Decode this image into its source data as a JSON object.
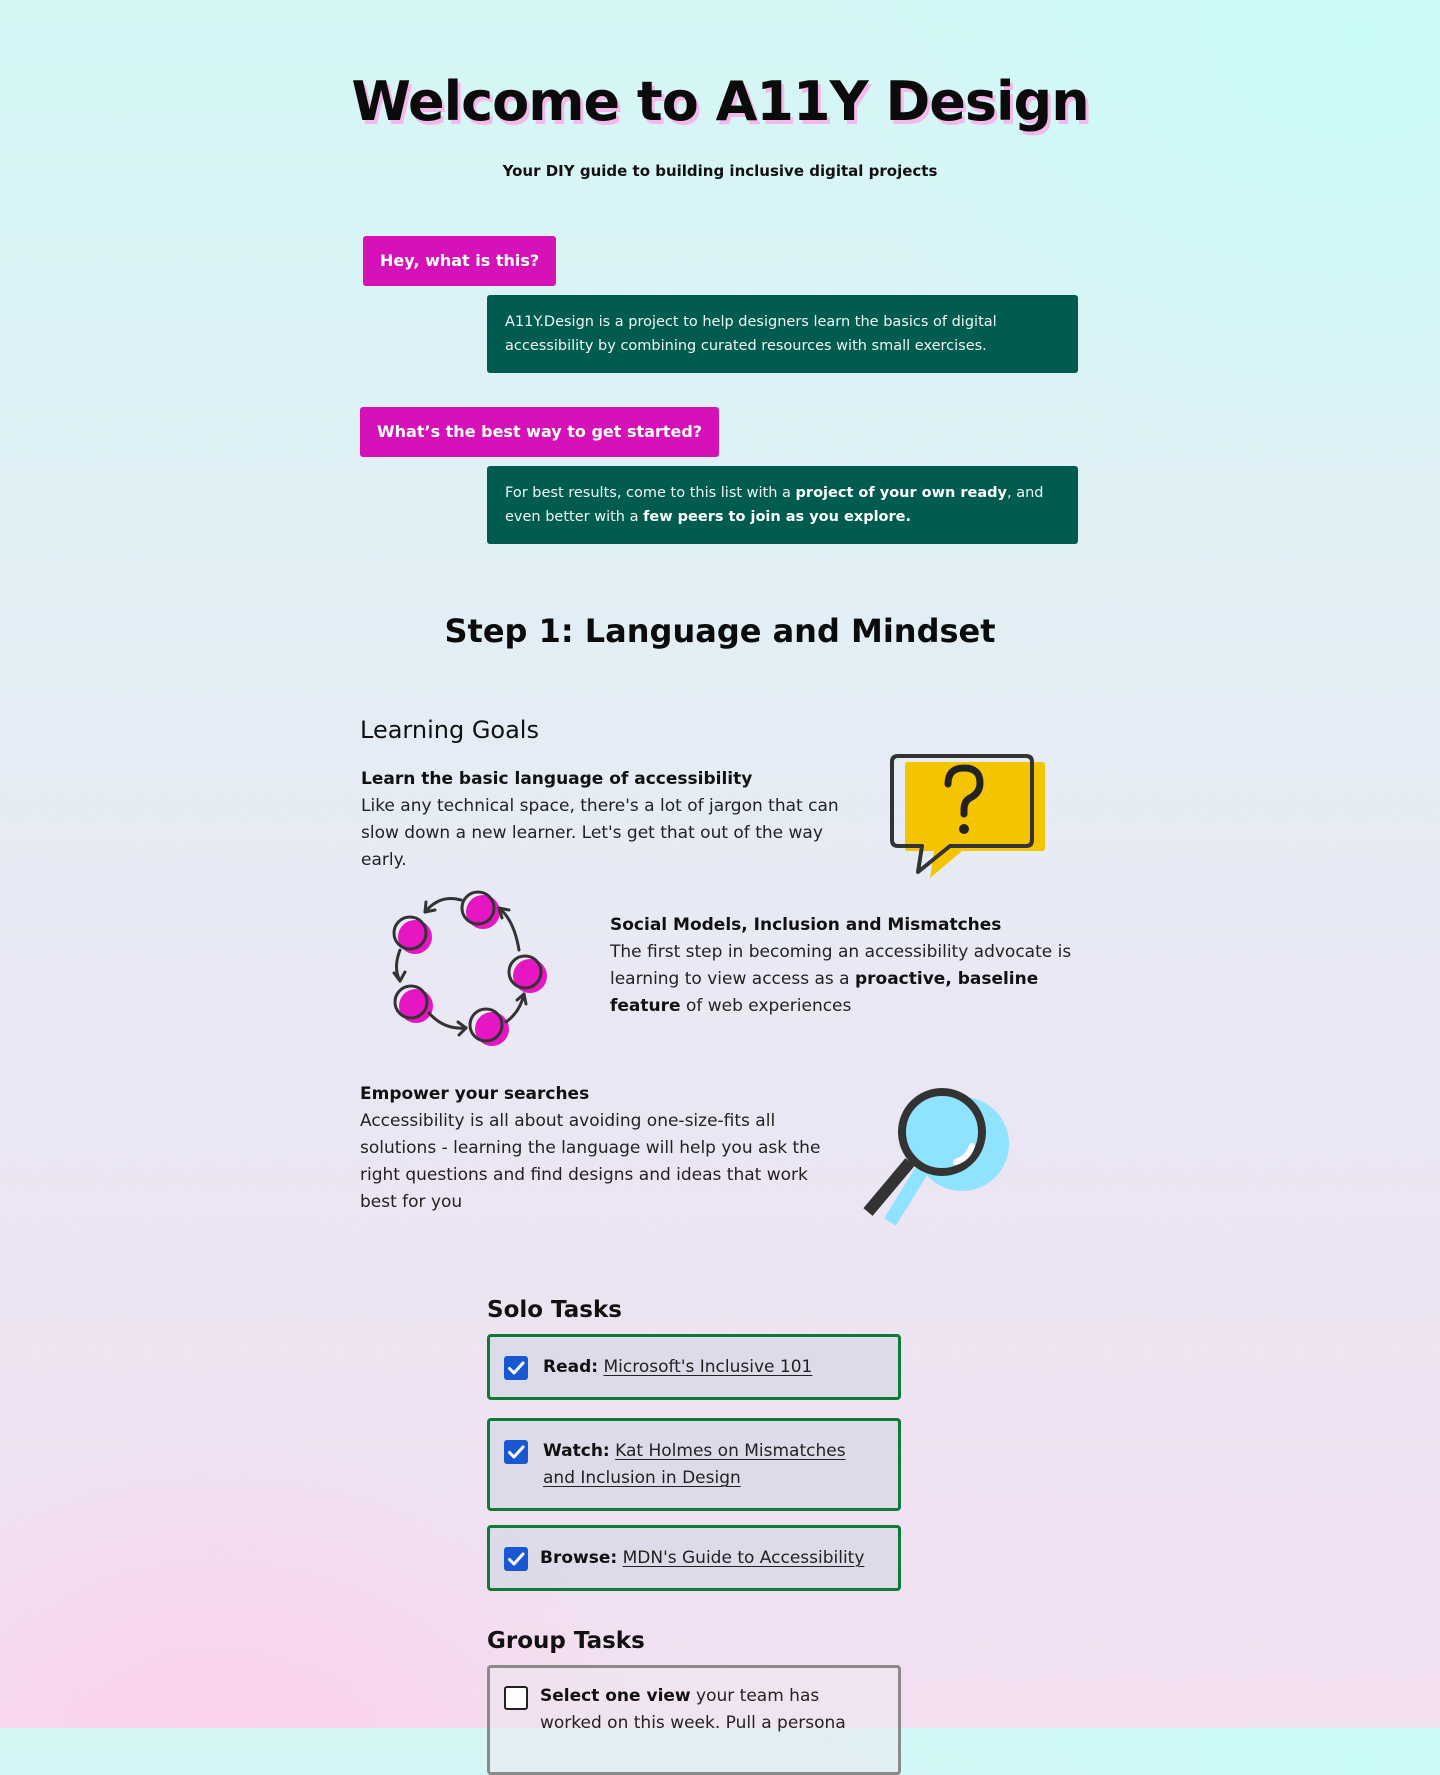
{
  "header": {
    "title": "Welcome to A11Y Design",
    "subtitle": "Your DIY guide to building inclusive  digital projects"
  },
  "faq": [
    {
      "question": "Hey, what is this?",
      "answer": "A11Y.Design is a project to help designers learn the basics of digital accessibility by combining curated resources with small exercises."
    },
    {
      "question": "What’s the best way to get started?",
      "answer_parts": {
        "p1": "For best results, come to this list with a ",
        "b1": "project of your own ready",
        "p2": ", and even better with a ",
        "b2": "few peers to join as you explore."
      }
    }
  ],
  "step": {
    "title": "Step 1: Language and Mindset"
  },
  "learning_goals": {
    "heading": "Learning Goals",
    "items": [
      {
        "title": "Learn the basic language of accessibility",
        "text": "Like any technical space, there's a lot of jargon that can slow down a new learner. Let's get that out of the way early.",
        "icon": "question-speech-bubble-icon"
      },
      {
        "title": "Social Models, Inclusion and Mismatches",
        "text_parts": {
          "p1": "The first step in becoming an accessibility advocate is learning to view access as a ",
          "b1": "proactive, baseline feature",
          "p2": " of web experiences"
        },
        "icon": "cycle-dots-icon"
      },
      {
        "title": "Empower your searches",
        "text": "Accessibility is all about avoiding one-size-fits all solutions - learning the language will help you ask the right questions and find designs and ideas that work best for you",
        "icon": "magnifying-glass-icon"
      }
    ]
  },
  "solo_tasks": {
    "heading": "Solo Tasks",
    "items": [
      {
        "verb": "Read:",
        "link": "Microsoft's Inclusive 101",
        "checked": true
      },
      {
        "verb": "Watch:",
        "link": "Kat Holmes on Mismatches and Inclusion in Design",
        "checked": true
      },
      {
        "verb": "Browse:",
        "link": "MDN's Guide to Accessibility",
        "checked": true
      }
    ]
  },
  "group_tasks": {
    "heading": "Group Tasks",
    "items": [
      {
        "bold": "Select one view",
        "text": " your team has worked on this week. Pull a persona",
        "checked": false
      }
    ]
  },
  "colors": {
    "question_bg": "#d412b8",
    "answer_bg": "#005c4f",
    "task_border": "#0f7a35",
    "checkbox": "#1958d0",
    "accent_yellow": "#f5c400",
    "accent_blue": "#8fe3ff"
  }
}
